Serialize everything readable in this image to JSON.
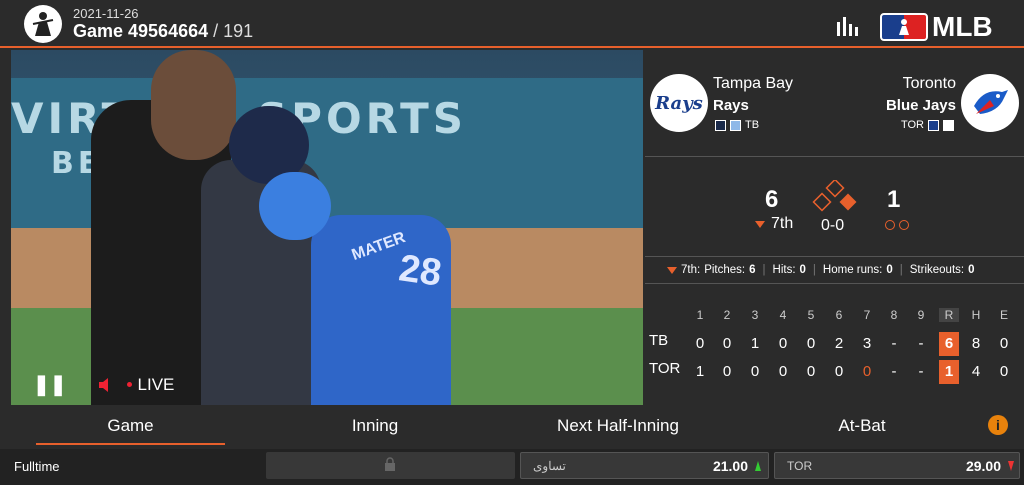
{
  "header": {
    "date": "2021-11-26",
    "game_label": "Game 49564664",
    "game_sub": " / 191",
    "brand": "MLB",
    "icons": [
      "virtual-sports-logo-icon",
      "stats-bars-icon",
      "mlb-logo-icon"
    ]
  },
  "video": {
    "banner_line1": "VIRTUAL SPORTS",
    "banner_line2": "BETTING",
    "player_number": "28",
    "player_name": "MATER",
    "live_label": "LIVE",
    "icons": [
      "pause-icon",
      "speaker-icon"
    ]
  },
  "home": {
    "city": "Tampa Bay",
    "name": "Rays",
    "abbr": "TB",
    "logo_text": "Rays"
  },
  "away": {
    "city": "Toronto",
    "name": "Blue Jays",
    "abbr": "TOR"
  },
  "score": {
    "home_runs": "6",
    "away_runs": "1",
    "inning": "7th",
    "count": "0-0"
  },
  "inning_stats": {
    "inning": "7th:",
    "pitches_label": "Pitches:",
    "pitches": "6",
    "hits_label": "Hits:",
    "hits": "0",
    "hr_label": "Home runs:",
    "hr": "0",
    "k_label": "Strikeouts:",
    "k": "0"
  },
  "box_score": {
    "headers": [
      "1",
      "2",
      "3",
      "4",
      "5",
      "6",
      "7",
      "8",
      "9",
      "R",
      "H",
      "E"
    ],
    "rows": [
      {
        "team": "TB",
        "cells": [
          "0",
          "0",
          "1",
          "0",
          "0",
          "2",
          "3",
          "-",
          "-",
          "6",
          "8",
          "0"
        ]
      },
      {
        "team": "TOR",
        "cells": [
          "1",
          "0",
          "0",
          "0",
          "0",
          "0",
          "0",
          "-",
          "-",
          "1",
          "4",
          "0"
        ]
      }
    ]
  },
  "tabs": [
    "Game",
    "Inning",
    "Next Half-Inning",
    "At-Bat"
  ],
  "bets": {
    "market": "Fulltime",
    "draw_label": "تساوی",
    "draw_odds": "21.00",
    "away_label": "TOR",
    "away_odds": "29.00"
  },
  "colors": {
    "accent": "#e8602c",
    "bg": "#2b2b2b"
  }
}
